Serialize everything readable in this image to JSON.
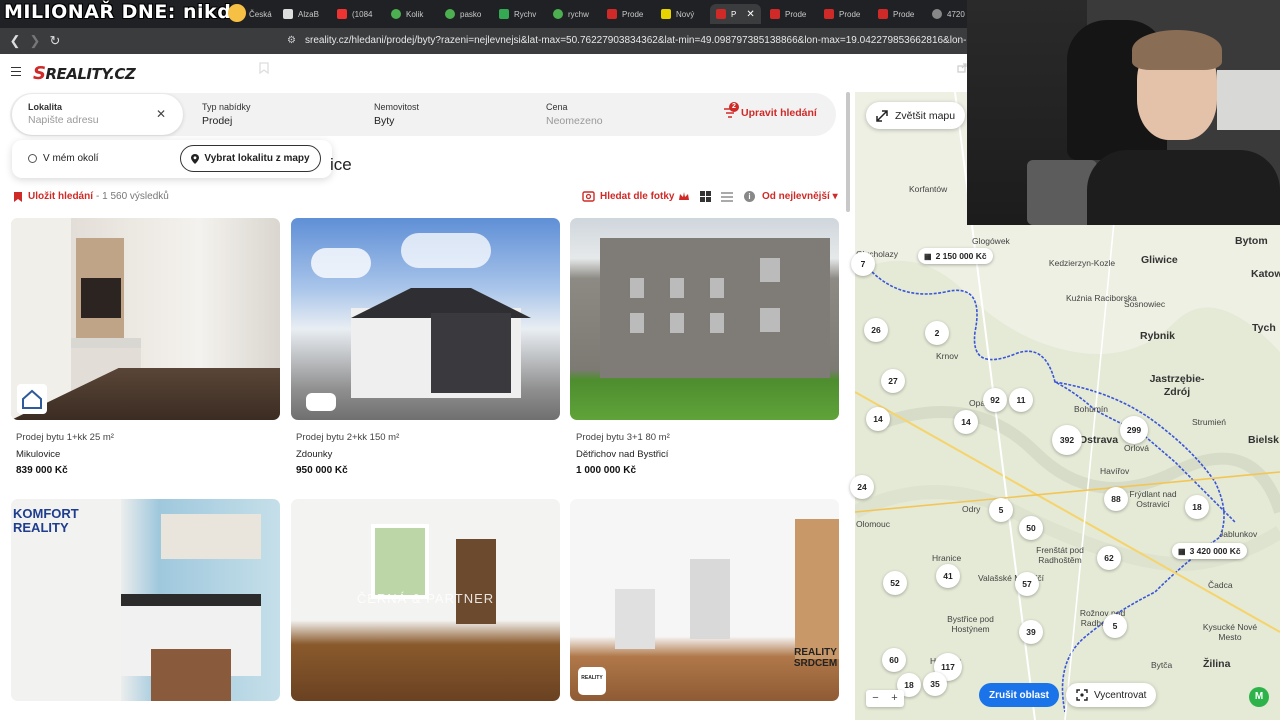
{
  "browser": {
    "overlay_title": "MILIONAŘ DNE: nikdo",
    "tabs": [
      {
        "label": "Česká",
        "color": "#e04b3f"
      },
      {
        "label": "AlzaB",
        "color": "#dddddd"
      },
      {
        "label": "(1084",
        "color": "#e33"
      },
      {
        "label": "Kolik",
        "color": "#4caf50"
      },
      {
        "label": "pasko",
        "color": "#4caf50"
      },
      {
        "label": "Rychv",
        "color": "#34a853"
      },
      {
        "label": "rychw",
        "color": "#4caf50"
      },
      {
        "label": "Prode",
        "color": "#cf2a27"
      },
      {
        "label": "Nový",
        "color": "#e6d300"
      },
      {
        "label": "P",
        "color": "#cf2a27"
      },
      {
        "label": "Prode",
        "color": "#cf2a27"
      },
      {
        "label": "Prode",
        "color": "#cf2a27"
      },
      {
        "label": "Prode",
        "color": "#cf2a27"
      },
      {
        "label": "4720",
        "color": "#888888"
      }
    ],
    "url": "sreality.cz/hledani/prodej/byty?razeni=nejlevnejsi&lat-max=50.76227903834362&lat-min=49.098797385138866&lon-max=19.042279853662816&lon-mi..."
  },
  "header": {
    "logo_text": "REALITY.CZ",
    "logo_mark": "S"
  },
  "search": {
    "lokalita_label": "Lokalita",
    "lokalita_placeholder": "Napište adresu",
    "typ_label": "Typ nabídky",
    "typ_value": "Prodej",
    "nemovitost_label": "Nemovitost",
    "nemovitost_value": "Byty",
    "cena_label": "Cena",
    "cena_value": "Neomezeno",
    "edit_label": "Upravit hledání",
    "edit_badge": "2",
    "dropdown_nearby": "V mém okolí",
    "dropdown_map": "Vybrat lokalitu z mapy",
    "heading_fragment": "ice"
  },
  "results": {
    "save_label": "Uložit hledání",
    "count": "- 1 560 výsledků",
    "photo_search": "Hledat dle fotky",
    "sort_label": "Od nejlevnější",
    "info": "i"
  },
  "listings": [
    {
      "title": "Prodej bytu 1+kk 25 m²",
      "location": "Mikulovice",
      "price": "839 000 Kč"
    },
    {
      "title": "Prodej bytu 2+kk 150 m²",
      "location": "Zdounky",
      "price": "950 000 Kč"
    },
    {
      "title": "Prodej bytu 3+1 80 m²",
      "location": "Dětřichov nad Bystřicí",
      "price": "1 000 000 Kč"
    },
    {
      "overlay": "KOMFORT REALITY"
    },
    {
      "overlay": "ČERNÁ & PARTNER"
    },
    {
      "overlay": "REALITY SRDCEM"
    }
  ],
  "map": {
    "enlarge_label": "Zvětšit mapu",
    "towns": [
      "Bytom",
      "Gliwice",
      "Katow",
      "Kedzierzyn-Kozle",
      "Glogówek",
      "Glucholazy",
      "Korfantów",
      "Sosnowiec",
      "Kuźnia Raciborska",
      "Rybnik",
      "Tych",
      "Krnov",
      "Jastrzębie-Zdrój",
      "Bohumín",
      "Ostrava",
      "Opava",
      "Strumień",
      "Bielsk",
      "Havířov",
      "Orlová",
      "Olomouc",
      "Odry",
      "Frýdlant nad Ostravicí",
      "Jablunkov",
      "Hranice",
      "Frenštát pod Radhoštěm",
      "Čadca",
      "Valašské Meziříčí",
      "Rožnov pod Radhoštěm",
      "Bystřice pod Hostýnem",
      "Holešov",
      "Žilina",
      "Bytča",
      "Kysucké Nové Mesto"
    ],
    "clusters": [
      "7",
      "26",
      "2",
      "27",
      "92",
      "11",
      "14",
      "14",
      "392",
      "299",
      "24",
      "88",
      "18",
      "5",
      "50",
      "62",
      "52",
      "41",
      "57",
      "39",
      "5",
      "60",
      "117",
      "18",
      "35"
    ],
    "price_tags": [
      "2 150 000 Kč",
      "3 420 000 Kč"
    ],
    "cancel_area": "Zrušit oblast",
    "recenter": "Vycentrovat",
    "zoom_out": "−",
    "zoom_in": "+",
    "badge": "M"
  },
  "colors": {
    "brand": "#cf2a27",
    "map_blue_button": "#1a73e8",
    "border_line": "#1f3fbf"
  }
}
